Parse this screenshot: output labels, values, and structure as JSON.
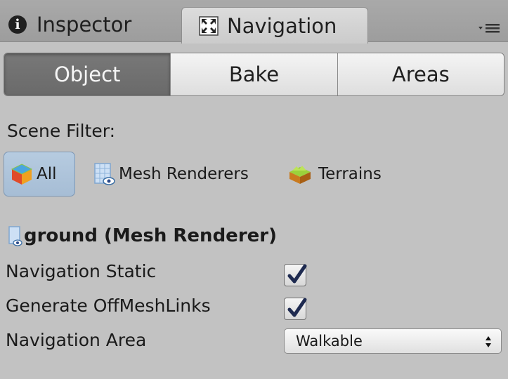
{
  "tabs": {
    "inspector": "Inspector",
    "navigation": "Navigation"
  },
  "toolbar": {
    "object": "Object",
    "bake": "Bake",
    "areas": "Areas"
  },
  "scene_filter": {
    "label": "Scene Filter:",
    "all": "All",
    "mesh_renderers": "Mesh Renderers",
    "terrains": "Terrains"
  },
  "object": {
    "title": "ground (Mesh Renderer)"
  },
  "properties": {
    "navigation_static": {
      "label": "Navigation Static",
      "checked": true
    },
    "generate_offmeshlinks": {
      "label": "Generate OffMeshLinks",
      "checked": true
    },
    "navigation_area": {
      "label": "Navigation Area",
      "value": "Walkable"
    }
  },
  "colors": {
    "background": "#c2c2c2",
    "active_segment": "#717171",
    "selected_filter": "#aec4da",
    "check": "#1e2a50"
  }
}
